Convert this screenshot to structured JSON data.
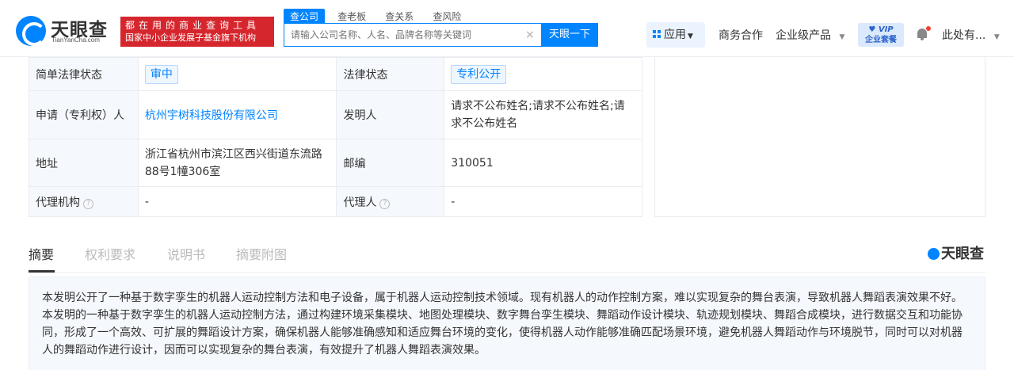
{
  "header": {
    "logo_cn": "天眼查",
    "logo_en": "TianYanCha.com",
    "slogan_line1": "都在用的商业查询工具",
    "slogan_line2": "国家中小企业发展子基金旗下机构",
    "search_tabs": [
      {
        "label": "查公司",
        "active": true
      },
      {
        "label": "查老板",
        "active": false
      },
      {
        "label": "查关系",
        "active": false
      },
      {
        "label": "查风险",
        "active": false
      }
    ],
    "search_placeholder": "请输入公司名称、人名、品牌名称等关键词",
    "clear_glyph": "×",
    "search_button": "天眼一下",
    "nav": {
      "apps": "应用",
      "business": "商务合作",
      "enterprise": "企业级产品",
      "vip_line1": "VIP",
      "vip_line2": "企业套餐",
      "user": "此处有..."
    }
  },
  "details": {
    "rows": [
      {
        "label1": "简单法律状态",
        "value1": "审中",
        "label2": "法律状态",
        "value2": "专利公开"
      },
      {
        "label1": "申请（专利权）人",
        "value1": "杭州宇树科技股份有限公司",
        "label2": "发明人",
        "value2": "请求不公布姓名;请求不公布姓名;请求不公布姓名"
      },
      {
        "label1": "地址",
        "value1": "浙江省杭州市滨江区西兴街道东流路88号1幢306室",
        "label2": "邮编",
        "value2": "310051"
      },
      {
        "label1": "代理机构",
        "value1": "-",
        "label2": "代理人",
        "value2": "-"
      }
    ],
    "help_glyph": "?"
  },
  "tabs": [
    {
      "label": "摘要",
      "active": true
    },
    {
      "label": "权利要求",
      "active": false
    },
    {
      "label": "说明书",
      "active": false
    },
    {
      "label": "摘要附图",
      "active": false
    }
  ],
  "watermark": "天眼查",
  "abstract_text": "本发明公开了一种基于数字孪生的机器人运动控制方法和电子设备，属于机器人运动控制技术领域。现有机器人的动作控制方案，难以实现复杂的舞台表演，导致机器人舞蹈表演效果不好。本发明的一种基于数字孪生的机器人运动控制方法，通过构建环境采集模块、地图处理模块、数字舞台孪生模块、舞蹈动作设计模块、轨迹规划模块、舞蹈合成模块，进行数据交互和功能协同，形成了一个高效、可扩展的舞蹈设计方案，确保机器人能够准确感知和适应舞台环境的变化，使得机器人动作能够准确匹配场景环境，避免机器人舞蹈动作与环境脱节，同时可以对机器人的舞蹈动作进行设计，因而可以实现复杂的舞台表演，有效提升了机器人舞蹈表演效果。",
  "colors": {
    "brand": "#0084ff",
    "slogan_bg": "#d6262d",
    "label_bg": "#f5f8fc"
  },
  "icons": [
    "logo-icon",
    "clear-icon",
    "grid-icon",
    "chevron-down-icon",
    "vip-diamond-icon",
    "bell-icon",
    "help-icon"
  ]
}
